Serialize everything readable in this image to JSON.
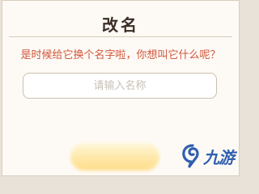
{
  "dialog": {
    "title": "改名",
    "prompt": "是时候给它换个名字啦，你想叫它什么呢？",
    "input": {
      "value": "",
      "placeholder": "请输入名称"
    },
    "confirm_button_label": ""
  },
  "watermark": {
    "text": "九游",
    "logo_icon": "jiuyou-logo-icon",
    "color": "#1b4fa8"
  },
  "colors": {
    "prompt": "#d2553a",
    "title": "#3a2e26",
    "background": "#fdfaf6"
  }
}
